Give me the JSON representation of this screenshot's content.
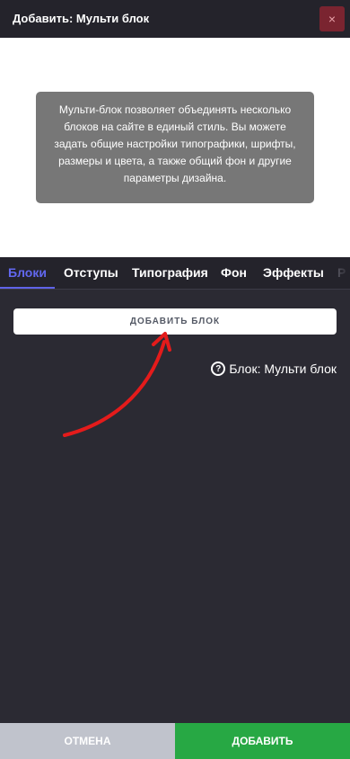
{
  "header": {
    "title": "Добавить: Мульти блок",
    "close_icon": "×"
  },
  "preview": {
    "tooltip_text": "Мульти-блок позволяет объединять несколько блоков на сайте в единый стиль. Вы можете задать общие настройки типографики, шрифты, размеры и цвета, а также общий фон и другие параметры дизайна."
  },
  "tabs": [
    {
      "label": "Блоки",
      "active": true
    },
    {
      "label": "Отступы"
    },
    {
      "label": "Типография"
    },
    {
      "label": "Фон"
    },
    {
      "label": "Эффекты"
    },
    {
      "label": "Р"
    }
  ],
  "content": {
    "add_block_label": "ДОБАВИТЬ БЛОК",
    "help_icon": "?",
    "help_label": "Блок: Мульти блок"
  },
  "footer": {
    "cancel_label": "ОТМЕНА",
    "add_label": "ДОБАВИТЬ"
  },
  "colors": {
    "accent": "#5f63e8",
    "add_button": "#27a844",
    "cancel_button": "#c0c3cc",
    "annotation_arrow": "#e41b1b"
  }
}
